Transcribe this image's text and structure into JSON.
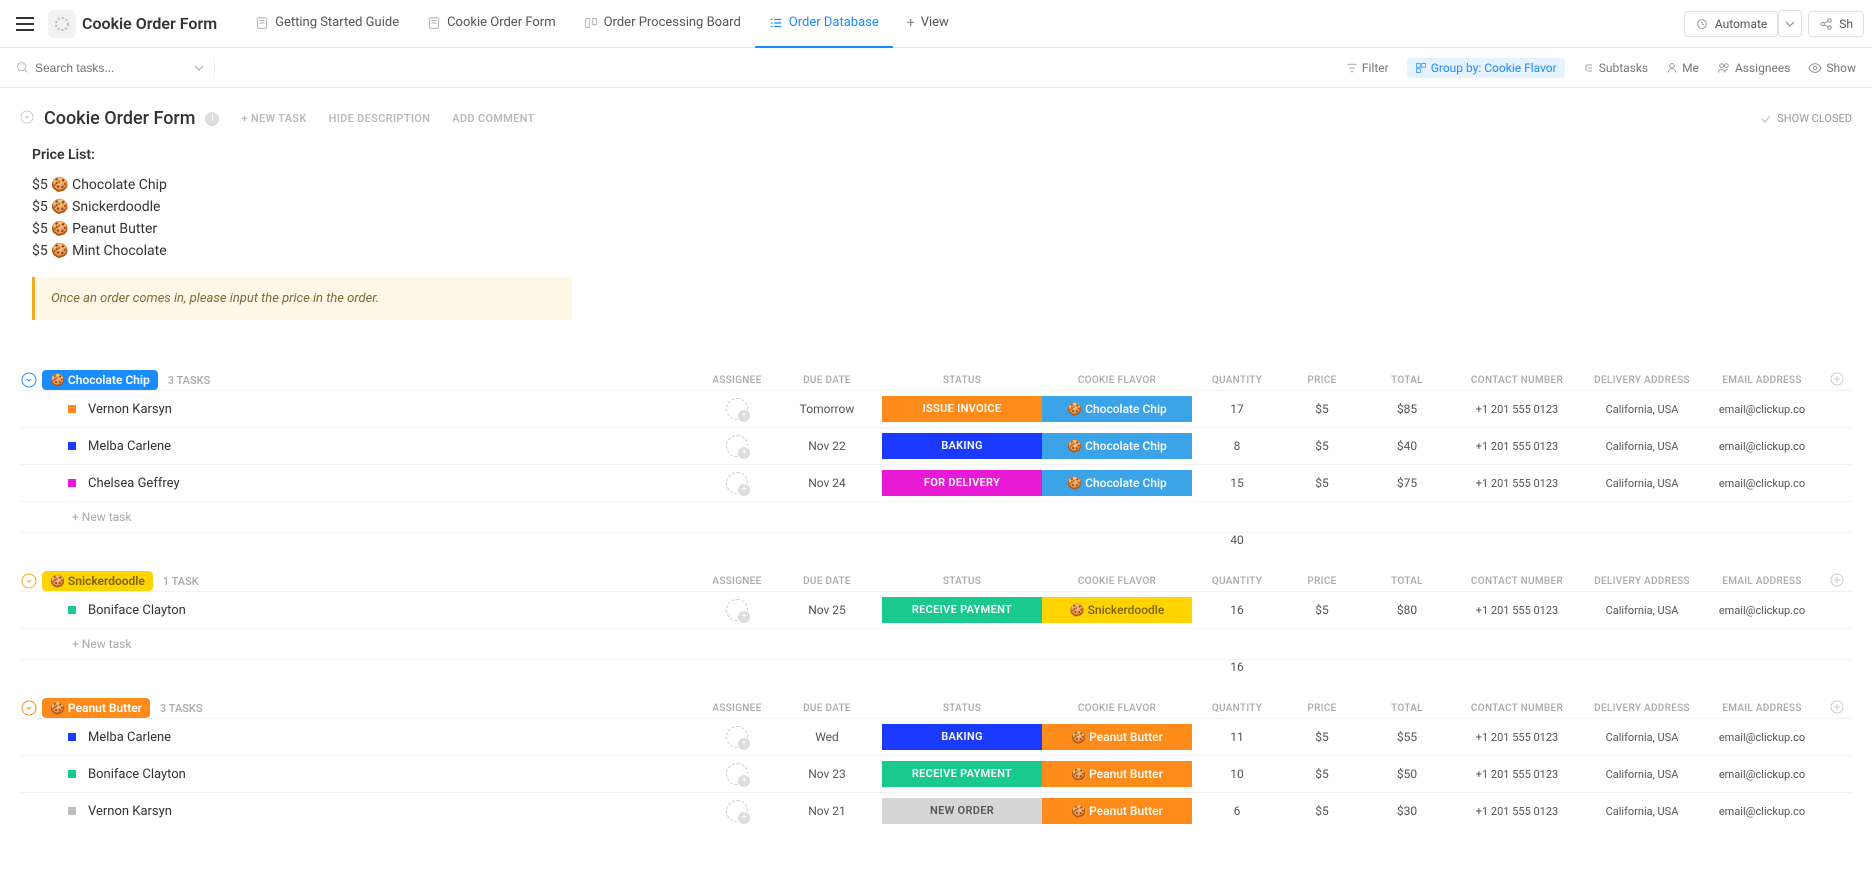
{
  "workspace_title": "Cookie Order Form",
  "tabs": [
    {
      "label": "Getting Started Guide"
    },
    {
      "label": "Cookie Order Form"
    },
    {
      "label": "Order Processing Board"
    },
    {
      "label": "Order Database"
    },
    {
      "label": "View"
    }
  ],
  "automate_label": "Automate",
  "share_label": "Sh",
  "search_placeholder": "Search tasks...",
  "toolbar": {
    "filter": "Filter",
    "groupby": "Group by: Cookie Flavor",
    "subtasks": "Subtasks",
    "me": "Me",
    "assignees": "Assignees",
    "show": "Show"
  },
  "list": {
    "title": "Cookie Order Form",
    "new_task": "+ NEW TASK",
    "hide_desc": "HIDE DESCRIPTION",
    "add_comment": "ADD COMMENT",
    "show_closed": "SHOW CLOSED"
  },
  "desc": {
    "heading": "Price List:",
    "items": [
      "$5 🍪 Chocolate Chip",
      "$5 🍪 Snickerdoodle",
      "$5 🍪 Peanut Butter",
      "$5 🍪 Mint Chocolate"
    ],
    "callout": "Once an order comes in, please input the price in the order."
  },
  "columns": [
    "ASSIGNEE",
    "DUE DATE",
    "STATUS",
    "COOKIE FLAVOR",
    "QUANTITY",
    "PRICE",
    "TOTAL",
    "CONTACT NUMBER",
    "DELIVERY ADDRESS",
    "EMAIL ADDRESS"
  ],
  "new_task_row": "+ New task",
  "groups": [
    {
      "name": "Chocolate Chip",
      "emoji": "🍪",
      "class": "choc",
      "chev_color": "#1a8cff",
      "count": "3 TASKS",
      "rows": [
        {
          "sq": "#ff8c1a",
          "name": "Vernon Karsyn",
          "due": "Tomorrow",
          "status": "ISSUE INVOICE",
          "status_bg": "#ff8c1a",
          "flavor": "Chocolate Chip",
          "flavor_bg": "#3ba3e8",
          "qty": "17",
          "price": "$5",
          "total": "$85",
          "contact": "+1 201 555 0123",
          "addr": "California, USA",
          "email": "email@clickup.co"
        },
        {
          "sq": "#1a3aff",
          "name": "Melba Carlene",
          "due": "Nov 22",
          "status": "BAKING",
          "status_bg": "#1a3aff",
          "flavor": "Chocolate Chip",
          "flavor_bg": "#3ba3e8",
          "qty": "8",
          "price": "$5",
          "total": "$40",
          "contact": "+1 201 555 0123",
          "addr": "California, USA",
          "email": "email@clickup.co"
        },
        {
          "sq": "#e81ad4",
          "name": "Chelsea Geffrey",
          "due": "Nov 24",
          "status": "FOR DELIVERY",
          "status_bg": "#e81ad4",
          "flavor": "Chocolate Chip",
          "flavor_bg": "#3ba3e8",
          "qty": "15",
          "price": "$5",
          "total": "$75",
          "contact": "+1 201 555 0123",
          "addr": "California, USA",
          "email": "email@clickup.co"
        }
      ],
      "sum_qty": "40"
    },
    {
      "name": "Snickerdoodle",
      "emoji": "🍪",
      "class": "snick",
      "chev_color": "#f5a623",
      "count": "1 TASK",
      "rows": [
        {
          "sq": "#1ac98e",
          "name": "Boniface Clayton",
          "due": "Nov 25",
          "status": "RECEIVE PAYMENT",
          "status_bg": "#1ac98e",
          "flavor": "Snickerdoodle",
          "flavor_bg": "#ffd400",
          "flavor_fg": "#7a6200",
          "qty": "16",
          "price": "$5",
          "total": "$80",
          "contact": "+1 201 555 0123",
          "addr": "California, USA",
          "email": "email@clickup.co"
        }
      ],
      "sum_qty": "16"
    },
    {
      "name": "Peanut Butter",
      "emoji": "🍪",
      "class": "peanut",
      "chev_color": "#ff8c1a",
      "count": "3 TASKS",
      "rows": [
        {
          "sq": "#1a3aff",
          "name": "Melba Carlene",
          "due": "Wed",
          "status": "BAKING",
          "status_bg": "#1a3aff",
          "flavor": "Peanut Butter",
          "flavor_bg": "#ff8c1a",
          "qty": "11",
          "price": "$5",
          "total": "$55",
          "contact": "+1 201 555 0123",
          "addr": "California, USA",
          "email": "email@clickup.co"
        },
        {
          "sq": "#1ac98e",
          "name": "Boniface Clayton",
          "due": "Nov 23",
          "status": "RECEIVE PAYMENT",
          "status_bg": "#1ac98e",
          "flavor": "Peanut Butter",
          "flavor_bg": "#ff8c1a",
          "qty": "10",
          "price": "$5",
          "total": "$50",
          "contact": "+1 201 555 0123",
          "addr": "California, USA",
          "email": "email@clickup.co"
        },
        {
          "sq": "#bfbfbf",
          "name": "Vernon Karsyn",
          "due": "Nov 21",
          "status": "NEW ORDER",
          "status_bg": "#d6d6d6",
          "status_fg": "#555",
          "flavor": "Peanut Butter",
          "flavor_bg": "#ff8c1a",
          "qty": "6",
          "price": "$5",
          "total": "$30",
          "contact": "+1 201 555 0123",
          "addr": "California, USA",
          "email": "email@clickup.co"
        }
      ]
    }
  ]
}
